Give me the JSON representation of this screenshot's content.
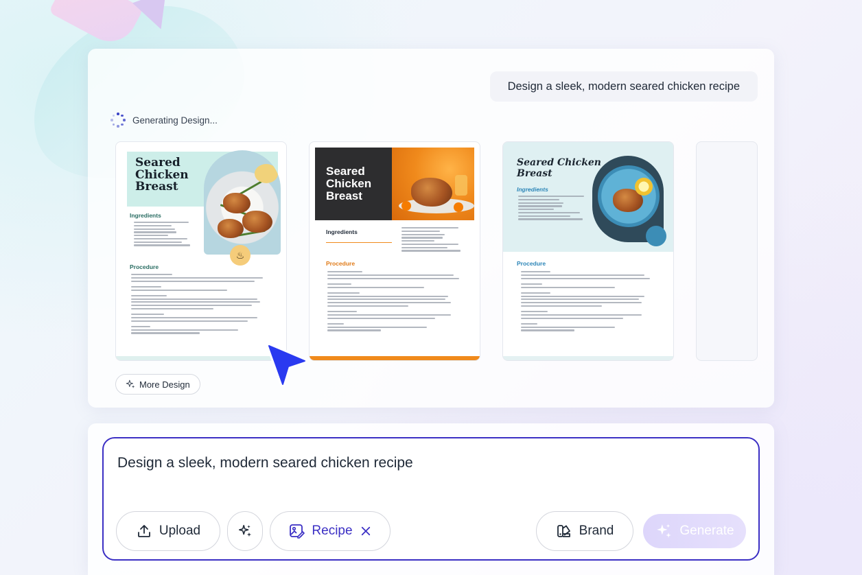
{
  "top": {
    "prompt_bubble": "Design a sleek, modern seared chicken recipe",
    "status_text": "Generating Design...",
    "more_design_label": "More Design"
  },
  "cards": [
    {
      "title_line1": "Seared",
      "title_line2": "Chicken",
      "title_line3": "Breast",
      "ingredients_heading": "Ingredients",
      "procedure_heading": "Procedure",
      "accent": "#2a6d63"
    },
    {
      "title_line1": "Seared",
      "title_line2": "Chicken",
      "title_line3": "Breast",
      "ingredients_heading": "Ingredients",
      "procedure_heading": "Procedure",
      "accent": "#f08a1c"
    },
    {
      "title_line1": "Seared Chicken",
      "title_line2": "Breast",
      "ingredients_heading": "Ingredients",
      "procedure_heading": "Procedure",
      "accent": "#2d86b8"
    }
  ],
  "composer": {
    "input_value": "Design a sleek, modern seared chicken recipe",
    "upload_label": "Upload",
    "template_chip_label": "Recipe",
    "brand_label": "Brand",
    "generate_label": "Generate"
  },
  "icons": {
    "upload": "upload-icon",
    "magic": "sparkle-icon",
    "recipe": "image-edit-icon",
    "remove": "close-icon",
    "brand": "brand-icon",
    "generate": "sparkle-icon"
  },
  "colors": {
    "primary": "#3b2fc4",
    "generate_disabled": "#ddd6fb"
  }
}
